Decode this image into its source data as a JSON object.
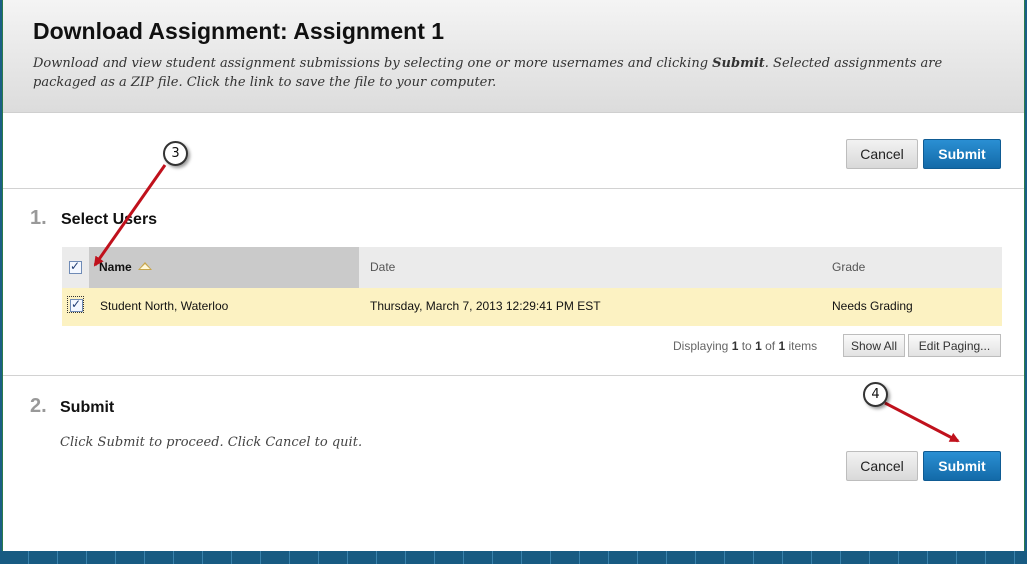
{
  "header": {
    "title": "Download Assignment: Assignment 1",
    "desc_part1": "Download and view student assignment submissions by selecting one or more usernames and clicking ",
    "desc_bold": "Submit",
    "desc_part2": ". Selected assignments are packaged as a ZIP file. Click the link to save the file to your computer."
  },
  "actions": {
    "cancel_label": "Cancel",
    "submit_label": "Submit"
  },
  "step1": {
    "number": "1.",
    "title": "Select Users"
  },
  "table": {
    "columns": {
      "name": "Name",
      "date": "Date",
      "grade": "Grade"
    },
    "rows": [
      {
        "name": "Student North, Waterloo",
        "date": "Thursday, March 7, 2013 12:29:41 PM EST",
        "grade": "Needs Grading",
        "checked": true
      }
    ],
    "header_checked": true
  },
  "paging": {
    "prefix": "Displaying ",
    "from": "1",
    "to_word": " to ",
    "to": "1",
    "of_word": " of ",
    "total": "1",
    "suffix": " items",
    "show_all_label": "Show All",
    "edit_paging_label": "Edit Paging..."
  },
  "step2": {
    "number": "2.",
    "title": "Submit",
    "instruction": "Click Submit to proceed. Click Cancel to quit."
  },
  "callouts": {
    "first": "3",
    "second": "4"
  },
  "colors": {
    "submit_blue": "#1a7bc1",
    "highlight_row": "#fcf2c2",
    "arrow_red": "#c0111c"
  }
}
